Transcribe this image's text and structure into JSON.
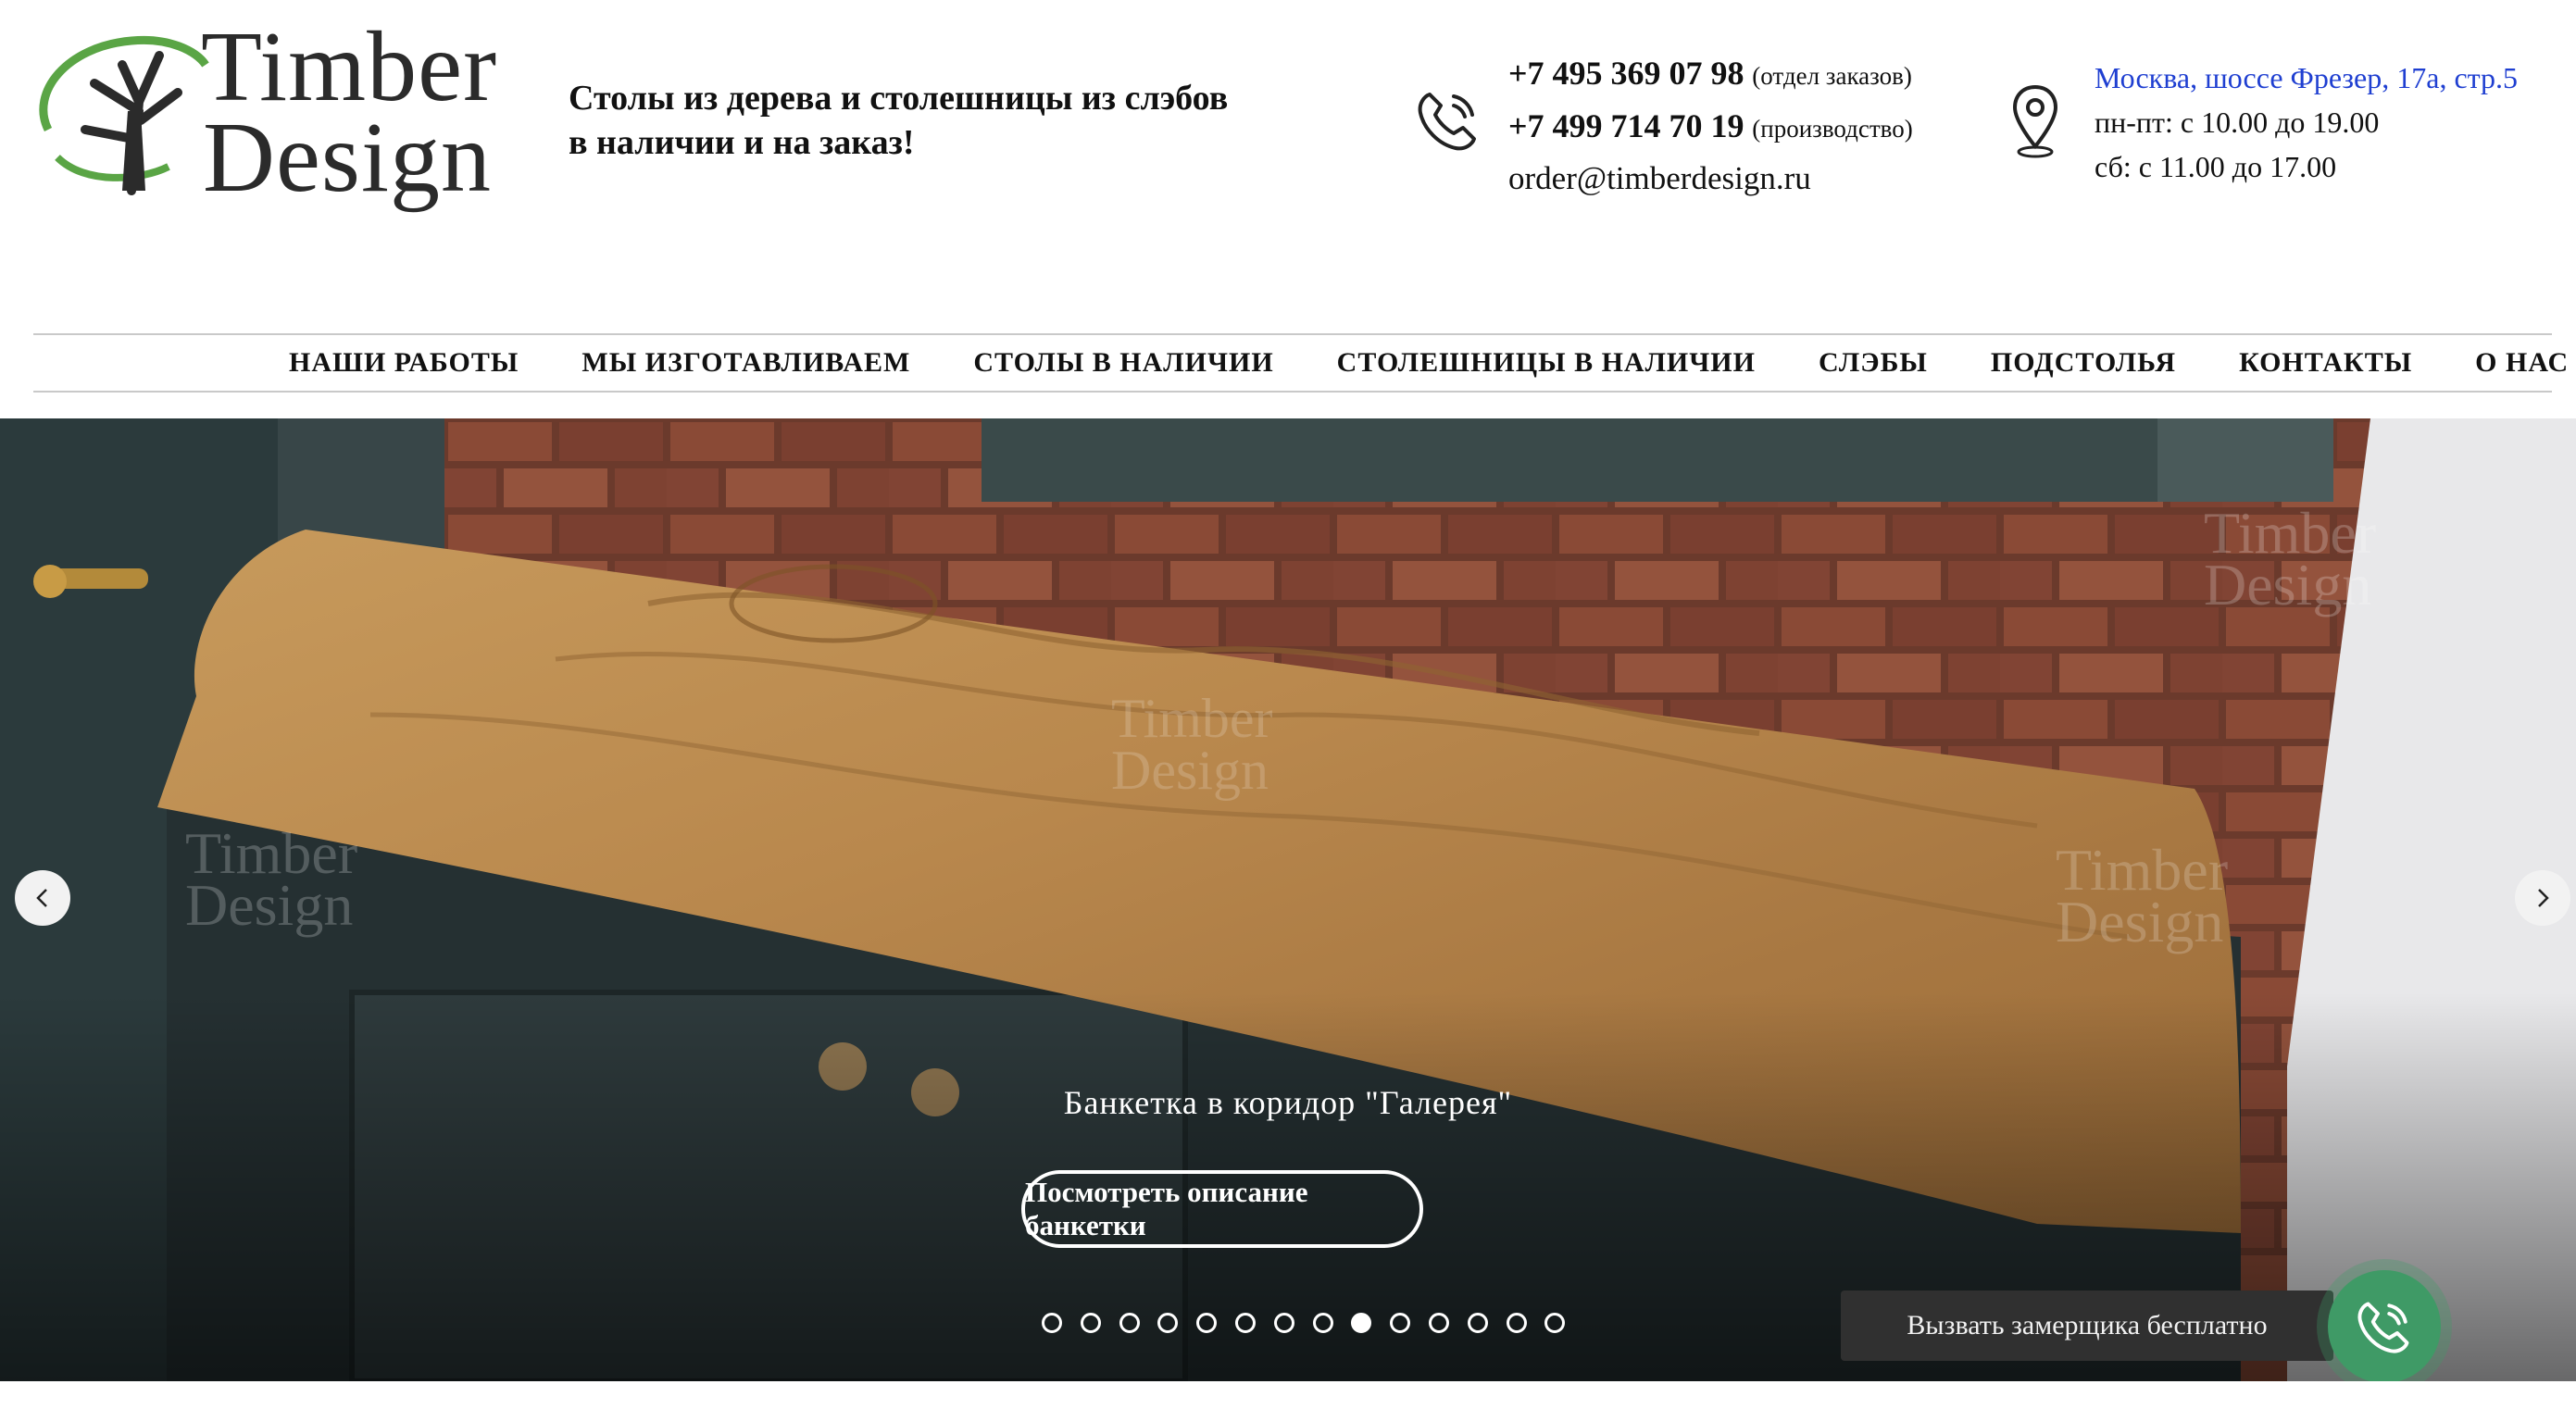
{
  "header": {
    "logo": {
      "line1": "Timber",
      "line2": "Design"
    },
    "tagline": {
      "line1": "Столы из дерева и столешницы из слэбов",
      "line2": "в наличии и на заказ!"
    },
    "contacts": {
      "phone1": "+7 495 369 07 98",
      "phone1_note": "(отдел заказов)",
      "phone2": "+7 499 714 70 19",
      "phone2_note": "(производство)",
      "email": "order@timberdesign.ru"
    },
    "address": {
      "link": "Москва, шоссе Фрезер, 17а, стр.5",
      "weekdays": "пн-пт: с 10.00 до 19.00",
      "saturday": "сб: с 11.00 до 17.00"
    }
  },
  "nav": {
    "items": [
      "НАШИ РАБОТЫ",
      "МЫ ИЗГОТАВЛИВАЕМ",
      "СТОЛЫ В НАЛИЧИИ",
      "СТОЛЕШНИЦЫ В НАЛИЧИИ",
      "СЛЭБЫ",
      "ПОДСТОЛЬЯ",
      "КОНТАКТЫ",
      "О НАС"
    ]
  },
  "hero": {
    "caption": "Банкетка в коридор \"Галерея\"",
    "cta": "Посмотреть описание банкетки",
    "slides_total": 14,
    "active_slide": 9,
    "watermark_line1": "Timber",
    "watermark_line2": "Design"
  },
  "callback": {
    "label": "Вызвать замерщика бесплатно",
    "icon": "phone-icon"
  },
  "colors": {
    "link": "#1f3fd1",
    "call_button": "#3f9a66",
    "logo_green": "#5aa545"
  }
}
